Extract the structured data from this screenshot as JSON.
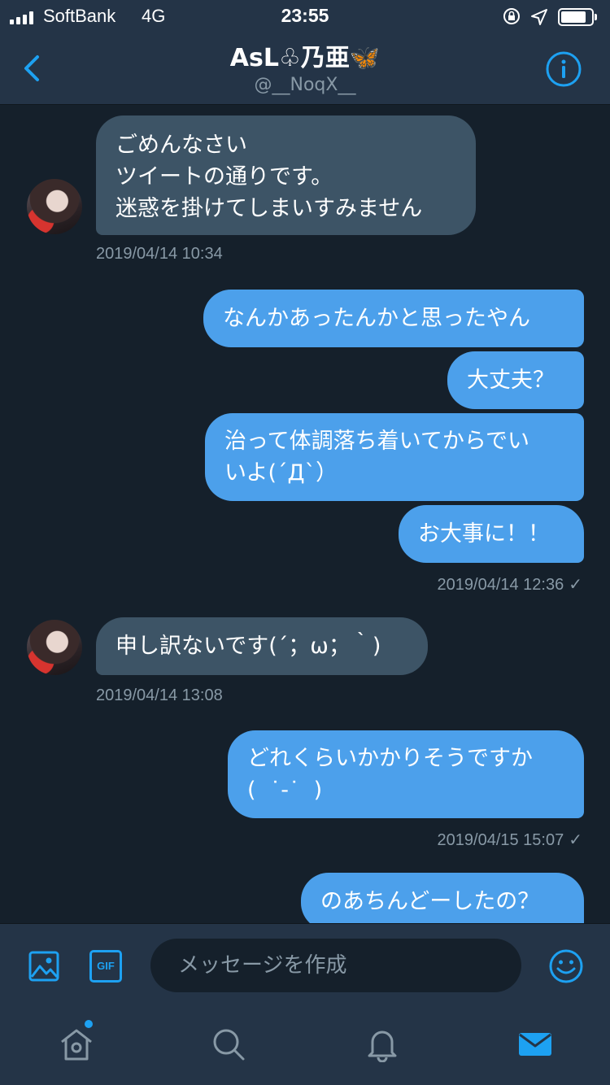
{
  "status_bar": {
    "carrier": "SoftBank",
    "network": "4G",
    "time": "23:55"
  },
  "header": {
    "title": "AsL♧乃亜🦋",
    "handle": "@__NoqX__"
  },
  "messages": [
    {
      "text": "ごめんなさい\nツイートの通りです。\n迷惑を掛けてしまいすみません",
      "direction": "in"
    },
    {
      "text": "2019/04/14 10:34",
      "type": "timestamp"
    },
    {
      "text": "なんかあったんかと思ったやん",
      "direction": "out"
    },
    {
      "text": "大丈夫？",
      "direction": "out"
    },
    {
      "text": "治って体調落ち着いてからでい\nいよ(´Д`）",
      "direction": "out"
    },
    {
      "text": "お大事に！！",
      "direction": "out"
    },
    {
      "text": "2019/04/14 12:36",
      "type": "timestamp"
    },
    {
      "text": "申し訳ないです(´；ω；｀)",
      "direction": "in"
    },
    {
      "text": "2019/04/14 13:08",
      "type": "timestamp"
    },
    {
      "text": "どれくらいかかりそうですか\n(  ˙-˙  )",
      "direction": "out"
    },
    {
      "text": "2019/04/15 15:07",
      "type": "timestamp"
    },
    {
      "text": "のあちんどーしたの？",
      "direction": "out"
    }
  ],
  "composer": {
    "placeholder": "メッセージを作成",
    "gif_label": "GIF"
  },
  "colors": {
    "background": "#15202b",
    "bar": "#243447",
    "incoming_bubble": "#3d5466",
    "outgoing_bubble": "#4ca0eb",
    "accent": "#1da1f2",
    "secondary_text": "#8899a6"
  },
  "icons": {
    "back": "chevron-left-icon",
    "info": "info-icon",
    "image": "image-icon",
    "emoji": "smiley-icon",
    "home": "home-icon",
    "search": "search-icon",
    "notifications": "bell-icon",
    "messages": "mail-icon"
  }
}
